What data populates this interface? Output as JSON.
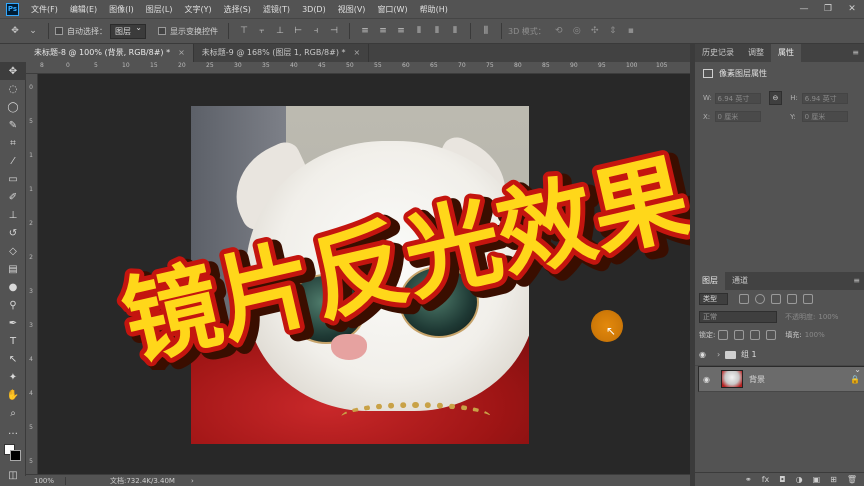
{
  "app": {
    "logo": "Ps"
  },
  "menu": [
    "文件(F)",
    "编辑(E)",
    "图像(I)",
    "图层(L)",
    "文字(Y)",
    "选择(S)",
    "滤镜(T)",
    "3D(D)",
    "视图(V)",
    "窗口(W)",
    "帮助(H)"
  ],
  "window_controls": {
    "minimize": "—",
    "restore": "❐",
    "close": "✕"
  },
  "options": {
    "auto_select_label": "自动选择：",
    "auto_select_value": "图层",
    "show_transform_label": "显示变换控件",
    "mode_3d_label": "3D 模式："
  },
  "tabs": [
    {
      "label": "未标题-8 @ 100% (背景, RGB/8#) *",
      "close": "×"
    },
    {
      "label": "未标题-9 @ 168% (图层 1, RGB/8#) *",
      "close": "×"
    }
  ],
  "ruler": {
    "top": [
      "8",
      "0",
      "5",
      "10",
      "15",
      "20",
      "25",
      "30",
      "35",
      "40",
      "45",
      "50",
      "55",
      "60",
      "65",
      "70",
      "75",
      "80",
      "85",
      "90",
      "95",
      "100",
      "105"
    ],
    "left": [
      "0",
      "5",
      "1",
      "1",
      "2",
      "2",
      "3",
      "3",
      "4",
      "4",
      "5",
      "5"
    ]
  },
  "headline": {
    "text": "镜片反光效果",
    "fill": "#ffd71a",
    "stroke": "#c4150f",
    "shadow": "#3a0e00"
  },
  "status": {
    "zoom": "100%",
    "doc": "文档:732.4K/3.40M",
    "arrow": "›"
  },
  "props_panel": {
    "tabs": [
      "历史记录",
      "调整",
      "属性"
    ],
    "active": 2,
    "title": "像素图层属性",
    "w_label": "W:",
    "w_value": "6.94 英寸",
    "h_label": "H:",
    "h_value": "6.94 英寸",
    "x_label": "X:",
    "x_value": "0 厘米",
    "y_label": "Y:",
    "y_value": "0 厘米",
    "link": "⊖"
  },
  "layers_panel": {
    "tabs": [
      "图层",
      "通道"
    ],
    "active": 0,
    "kind_label": "类型",
    "blend_mode": "正常",
    "opacity_label": "不透明度:",
    "opacity_value": "100%",
    "lock_label": "锁定:",
    "fill_label": "填充:",
    "fill_value": "100%",
    "layers": [
      {
        "name": "组 1",
        "type": "group"
      },
      {
        "name": "背景",
        "type": "image",
        "locked": true
      }
    ],
    "footer": [
      "⚭",
      "fx",
      "◘",
      "◑",
      "▣",
      "⊞",
      "🗑"
    ]
  },
  "tools": [
    "move",
    "marquee",
    "lasso",
    "quick-select",
    "crop",
    "eyedropper",
    "heal",
    "brush",
    "stamp",
    "history-brush",
    "eraser",
    "gradient",
    "blur",
    "dodge",
    "pen",
    "type",
    "path-select",
    "shape",
    "hand",
    "zoom",
    "more",
    "colors",
    "quickmask"
  ]
}
